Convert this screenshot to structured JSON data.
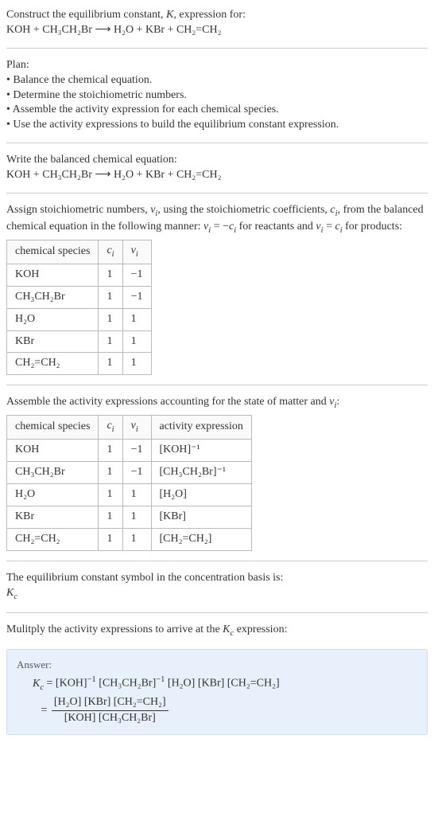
{
  "intro": {
    "line1": "Construct the equilibrium constant, K, expression for:",
    "equation": "KOH + CH₃CH₂Br  ⟶  H₂O + KBr + CH₂=CH₂"
  },
  "plan": {
    "heading": "Plan:",
    "items": [
      "Balance the chemical equation.",
      "Determine the stoichiometric numbers.",
      "Assemble the activity expression for each chemical species.",
      "Use the activity expressions to build the equilibrium constant expression."
    ]
  },
  "balanced": {
    "heading": "Write the balanced chemical equation:",
    "equation": "KOH + CH₃CH₂Br  ⟶  H₂O + KBr + CH₂=CH₂"
  },
  "stoich": {
    "heading_a": "Assign stoichiometric numbers, νᵢ, using the stoichiometric coefficients, cᵢ, from the balanced chemical equation in the following manner: νᵢ = −cᵢ for reactants and νᵢ = cᵢ for products:",
    "headers": [
      "chemical species",
      "cᵢ",
      "νᵢ"
    ],
    "rows": [
      [
        "KOH",
        "1",
        "−1"
      ],
      [
        "CH₃CH₂Br",
        "1",
        "−1"
      ],
      [
        "H₂O",
        "1",
        "1"
      ],
      [
        "KBr",
        "1",
        "1"
      ],
      [
        "CH₂=CH₂",
        "1",
        "1"
      ]
    ]
  },
  "activity": {
    "heading": "Assemble the activity expressions accounting for the state of matter and νᵢ:",
    "headers": [
      "chemical species",
      "cᵢ",
      "νᵢ",
      "activity expression"
    ],
    "rows": [
      [
        "KOH",
        "1",
        "−1",
        "[KOH]⁻¹"
      ],
      [
        "CH₃CH₂Br",
        "1",
        "−1",
        "[CH₃CH₂Br]⁻¹"
      ],
      [
        "H₂O",
        "1",
        "1",
        "[H₂O]"
      ],
      [
        "KBr",
        "1",
        "1",
        "[KBr]"
      ],
      [
        "CH₂=CH₂",
        "1",
        "1",
        "[CH₂=CH₂]"
      ]
    ]
  },
  "symbol": {
    "line1": "The equilibrium constant symbol in the concentration basis is:",
    "line2": "K_c"
  },
  "multiply": {
    "heading": "Mulitply the activity expressions to arrive at the K_c expression:"
  },
  "answer": {
    "label": "Answer:",
    "line1": "K_c = [KOH]⁻¹ [CH₃CH₂Br]⁻¹ [H₂O] [KBr] [CH₂=CH₂]",
    "numerator": "[H₂O] [KBr] [CH₂=CH₂]",
    "denominator": "[KOH] [CH₃CH₂Br]"
  }
}
